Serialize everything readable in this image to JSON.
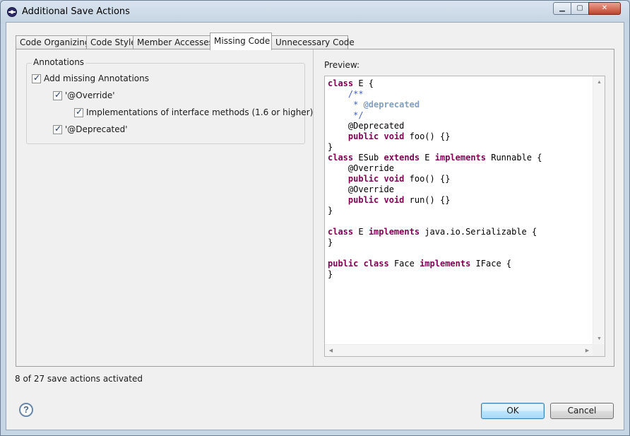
{
  "window": {
    "title": "Additional Save Actions",
    "controls": {
      "minimize": "▁",
      "maximize": "▢",
      "close": "✕"
    }
  },
  "tabs": [
    {
      "label": "Code Organizing",
      "active": false
    },
    {
      "label": "Code Style",
      "active": false
    },
    {
      "label": "Member Accesses",
      "active": false
    },
    {
      "label": "Missing Code",
      "active": true
    },
    {
      "label": "Unnecessary Code",
      "active": false
    }
  ],
  "annotations": {
    "group_label": "Annotations",
    "add_missing": {
      "label": "Add missing Annotations",
      "checked": true
    },
    "override": {
      "label": "'@Override'",
      "checked": true
    },
    "interface_methods": {
      "label": "Implementations of interface methods (1.6 or higher)",
      "checked": true
    },
    "deprecated": {
      "label": "'@Deprecated'",
      "checked": true
    }
  },
  "preview": {
    "label": "Preview:",
    "code_lines": [
      [
        [
          "kw",
          "class"
        ],
        [
          "t",
          " E {"
        ]
      ],
      [
        [
          "t",
          "    "
        ],
        [
          "jd",
          "/**"
        ]
      ],
      [
        [
          "t",
          "     "
        ],
        [
          "jd",
          "* "
        ],
        [
          "jdtag",
          "@deprecated"
        ]
      ],
      [
        [
          "t",
          "     "
        ],
        [
          "jd",
          "*/"
        ]
      ],
      [
        [
          "t",
          "    @Deprecated"
        ]
      ],
      [
        [
          "t",
          "    "
        ],
        [
          "kw",
          "public"
        ],
        [
          "t",
          " "
        ],
        [
          "kw",
          "void"
        ],
        [
          "t",
          " foo() {}"
        ]
      ],
      [
        [
          "t",
          "}"
        ]
      ],
      [
        [
          "kw",
          "class"
        ],
        [
          "t",
          " ESub "
        ],
        [
          "kw",
          "extends"
        ],
        [
          "t",
          " E "
        ],
        [
          "kw",
          "implements"
        ],
        [
          "t",
          " Runnable {"
        ]
      ],
      [
        [
          "t",
          "    @Override"
        ]
      ],
      [
        [
          "t",
          "    "
        ],
        [
          "kw",
          "public"
        ],
        [
          "t",
          " "
        ],
        [
          "kw",
          "void"
        ],
        [
          "t",
          " foo() {}"
        ]
      ],
      [
        [
          "t",
          "    @Override"
        ]
      ],
      [
        [
          "t",
          "    "
        ],
        [
          "kw",
          "public"
        ],
        [
          "t",
          " "
        ],
        [
          "kw",
          "void"
        ],
        [
          "t",
          " run() {}"
        ]
      ],
      [
        [
          "t",
          "}"
        ]
      ],
      [
        [
          "t",
          ""
        ]
      ],
      [
        [
          "kw",
          "class"
        ],
        [
          "t",
          " E "
        ],
        [
          "kw",
          "implements"
        ],
        [
          "t",
          " java.io.Serializable {"
        ]
      ],
      [
        [
          "t",
          "}"
        ]
      ],
      [
        [
          "t",
          ""
        ]
      ],
      [
        [
          "kw",
          "public"
        ],
        [
          "t",
          " "
        ],
        [
          "kw",
          "class"
        ],
        [
          "t",
          " Face "
        ],
        [
          "kw",
          "implements"
        ],
        [
          "t",
          " IFace {"
        ]
      ],
      [
        [
          "t",
          "}"
        ]
      ]
    ]
  },
  "status": {
    "text": "8 of 27 save actions activated"
  },
  "buttons": {
    "help": "?",
    "ok": "OK",
    "cancel": "Cancel"
  },
  "colors": {
    "keyword": "#7f0055",
    "javadoc": "#3f5fbf",
    "javadoc_tag": "#7f9fbf",
    "ok_border": "#3c7fb1"
  }
}
